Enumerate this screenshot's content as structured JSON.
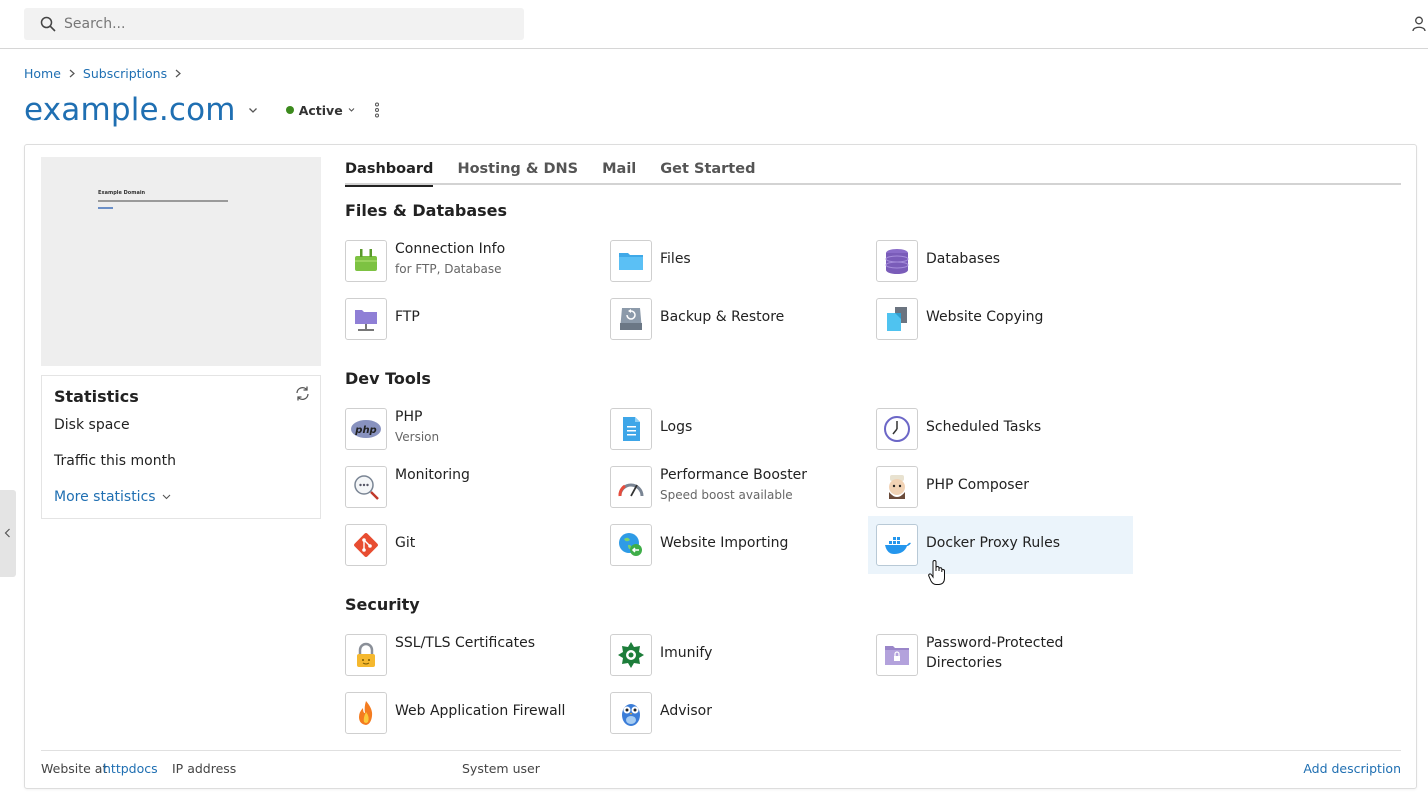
{
  "search": {
    "placeholder": "Search..."
  },
  "breadcrumb": {
    "home": "Home",
    "subscriptions": "Subscriptions"
  },
  "domain": {
    "title": "example.com",
    "status": "Active"
  },
  "preview": {
    "heading": "Example Domain"
  },
  "statistics": {
    "title": "Statistics",
    "disk_space": "Disk space",
    "traffic": "Traffic this month",
    "more": "More statistics"
  },
  "tabs": [
    "Dashboard",
    "Hosting & DNS",
    "Mail",
    "Get Started"
  ],
  "sections": {
    "files": "Files & Databases",
    "dev": "Dev Tools",
    "security": "Security"
  },
  "tools": {
    "connection_info": {
      "label": "Connection Info",
      "sub": "for FTP, Database"
    },
    "files": {
      "label": "Files"
    },
    "databases": {
      "label": "Databases"
    },
    "ftp": {
      "label": "FTP"
    },
    "backup": {
      "label": "Backup & Restore"
    },
    "website_copying": {
      "label": "Website Copying"
    },
    "php": {
      "label": "PHP",
      "sub": "Version"
    },
    "logs": {
      "label": "Logs"
    },
    "scheduled_tasks": {
      "label": "Scheduled Tasks"
    },
    "monitoring": {
      "label": "Monitoring"
    },
    "performance_booster": {
      "label": "Performance Booster",
      "sub": "Speed boost available"
    },
    "php_composer": {
      "label": "PHP Composer"
    },
    "git": {
      "label": "Git"
    },
    "website_importing": {
      "label": "Website Importing"
    },
    "docker_proxy": {
      "label": "Docker Proxy Rules"
    },
    "ssl": {
      "label": "SSL/TLS Certificates"
    },
    "imunify": {
      "label": "Imunify"
    },
    "password_dirs": {
      "label": "Password-Protected",
      "label2": "Directories"
    },
    "waf": {
      "label": "Web Application Firewall"
    },
    "advisor": {
      "label": "Advisor"
    }
  },
  "footer": {
    "website_at": "Website at",
    "httpdocs": "httpdocs",
    "ip": "IP address",
    "system_user": "System user",
    "add_description": "Add description"
  },
  "colors": {
    "accent": "#1f6fb2",
    "active": "#3c8a1d",
    "hover_bg": "#ebf4fb"
  }
}
